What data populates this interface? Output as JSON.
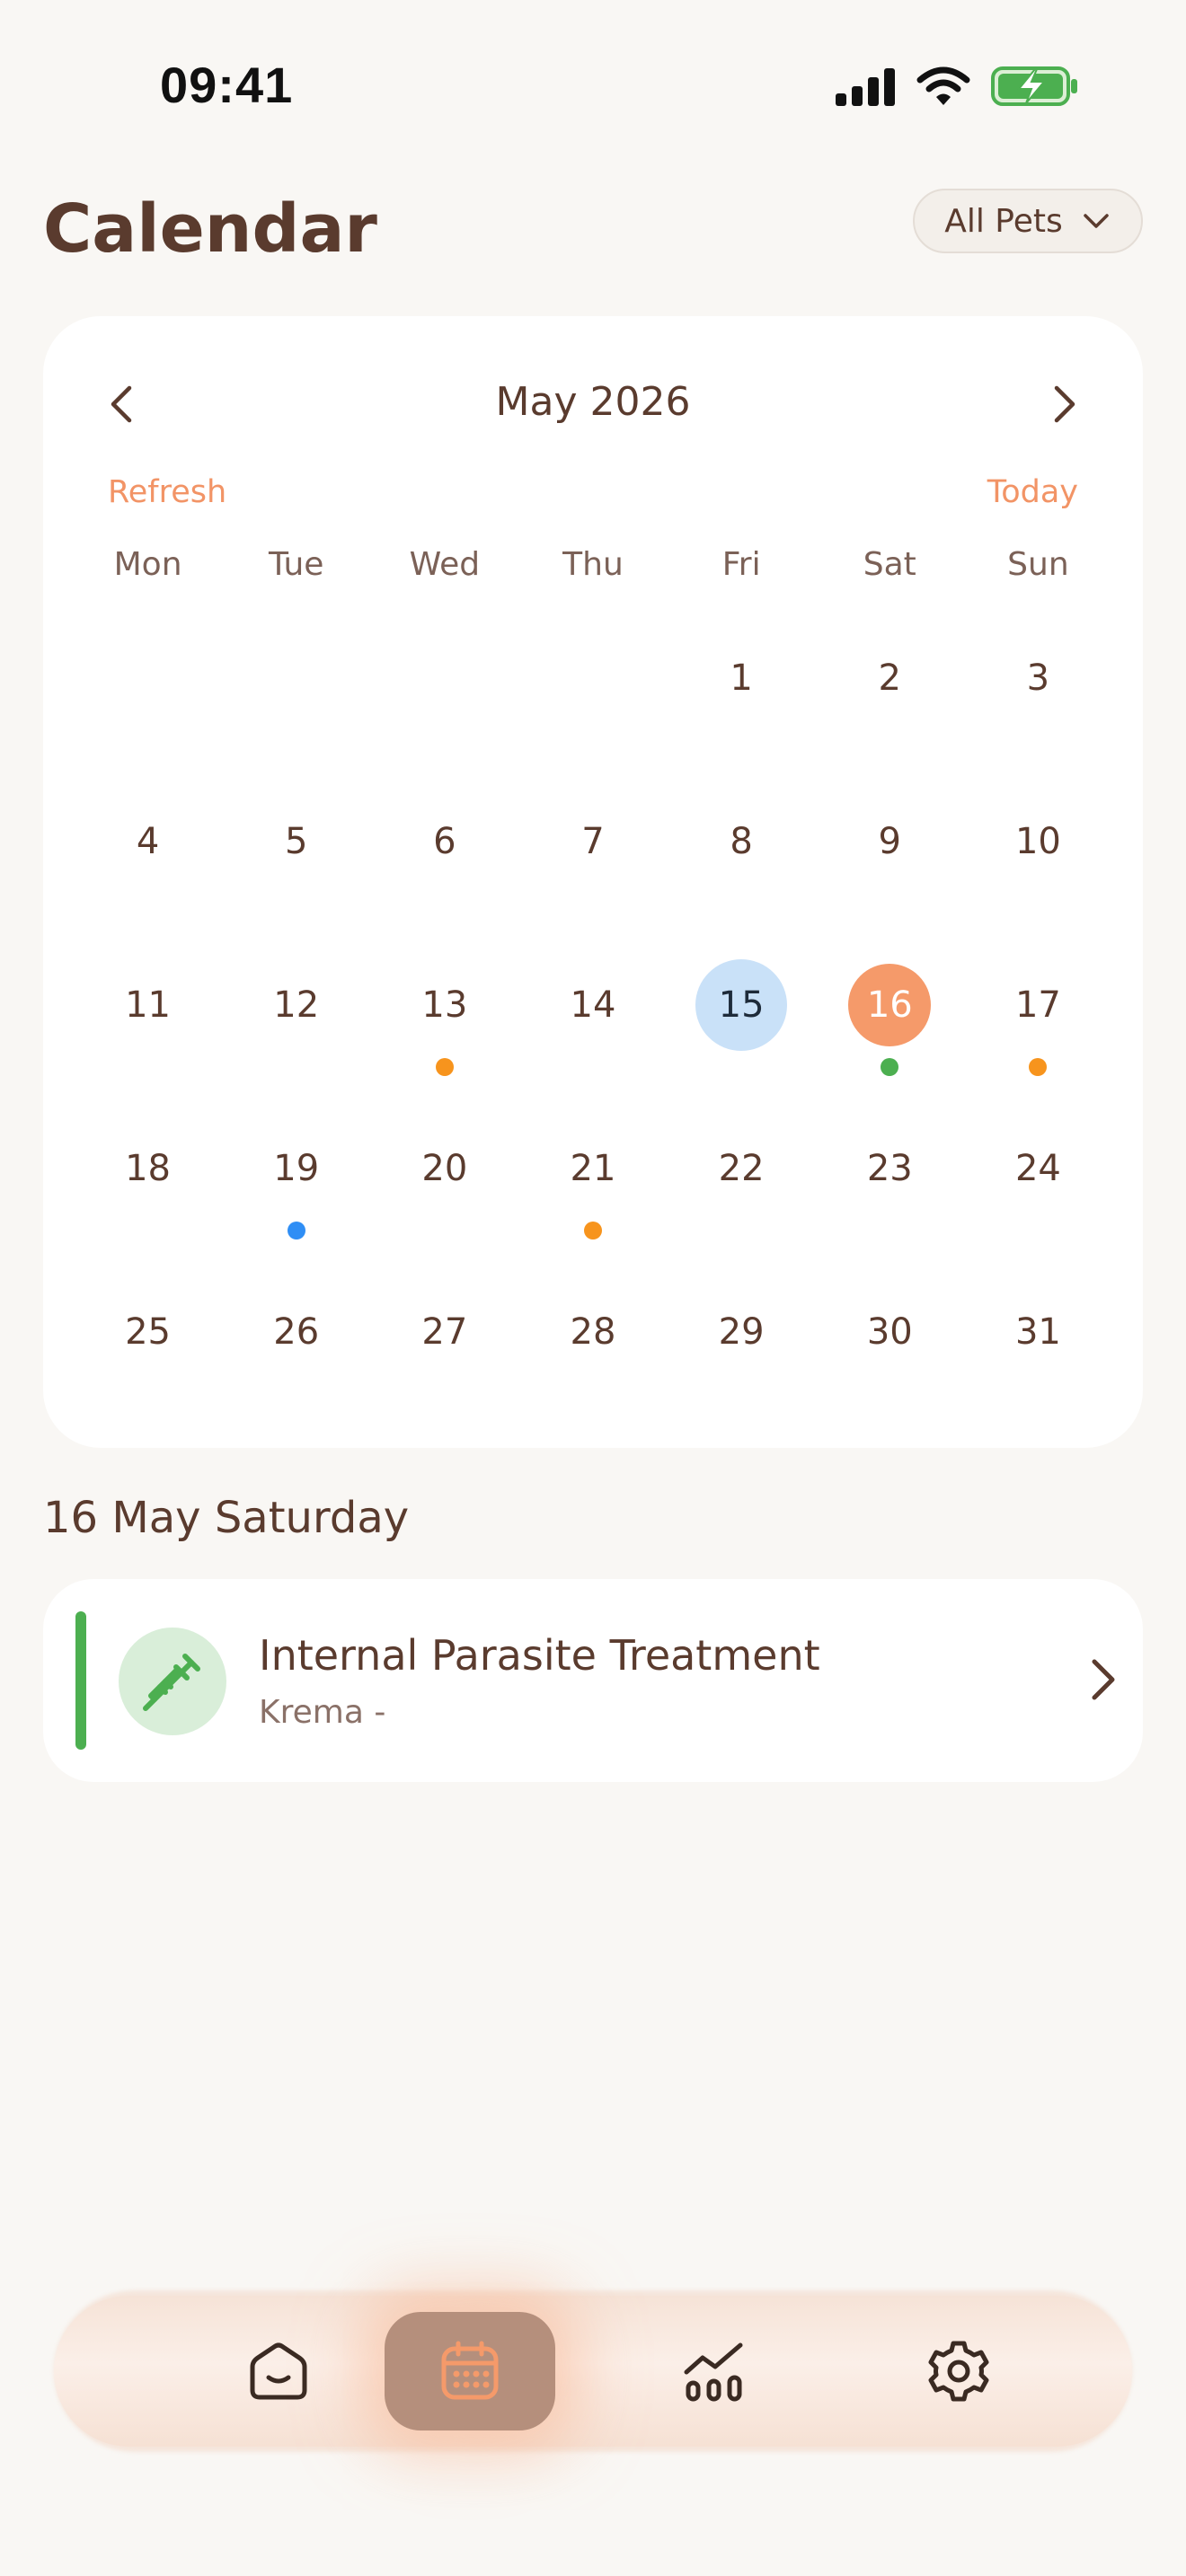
{
  "status_bar": {
    "time": "09:41"
  },
  "header": {
    "title": "Calendar",
    "pet_filter_label": "All Pets"
  },
  "calendar": {
    "month_label": "May 2026",
    "refresh_label": "Refresh",
    "today_label": "Today",
    "weekdays": [
      "Mon",
      "Tue",
      "Wed",
      "Thu",
      "Fri",
      "Sat",
      "Sun"
    ],
    "leading_blank_days": 4,
    "days": [
      {
        "label": "1"
      },
      {
        "label": "2"
      },
      {
        "label": "3"
      },
      {
        "label": "4"
      },
      {
        "label": "5"
      },
      {
        "label": "6"
      },
      {
        "label": "7"
      },
      {
        "label": "8"
      },
      {
        "label": "9"
      },
      {
        "label": "10"
      },
      {
        "label": "11"
      },
      {
        "label": "12"
      },
      {
        "label": "13",
        "dot_color": "#f7941d"
      },
      {
        "label": "14"
      },
      {
        "label": "15",
        "today": true
      },
      {
        "label": "16",
        "selected": true,
        "dot_color": "#4caf50"
      },
      {
        "label": "17",
        "dot_color": "#f7941d"
      },
      {
        "label": "18"
      },
      {
        "label": "19",
        "dot_color": "#2f8ef5"
      },
      {
        "label": "20"
      },
      {
        "label": "21",
        "dot_color": "#f7941d"
      },
      {
        "label": "22"
      },
      {
        "label": "23"
      },
      {
        "label": "24"
      },
      {
        "label": "25"
      },
      {
        "label": "26"
      },
      {
        "label": "27"
      },
      {
        "label": "28"
      },
      {
        "label": "29"
      },
      {
        "label": "30"
      },
      {
        "label": "31"
      }
    ]
  },
  "selected_day": {
    "label": "16 May Saturday",
    "events": [
      {
        "title": "Internal Parasite Treatment",
        "subtitle": "Krema -",
        "icon": "syringe-icon",
        "accent": "#4caf50"
      }
    ]
  },
  "tab_bar": {
    "items": [
      {
        "name": "home",
        "icon": "home-icon"
      },
      {
        "name": "calendar",
        "icon": "calendar-icon",
        "active": true
      },
      {
        "name": "stats",
        "icon": "chart-icon"
      },
      {
        "name": "settings",
        "icon": "gear-icon"
      }
    ]
  },
  "colors": {
    "accent": "#f59a6a",
    "text": "#5a3b2e",
    "today": "#c9e1f8",
    "background": "#f9f7f4"
  }
}
